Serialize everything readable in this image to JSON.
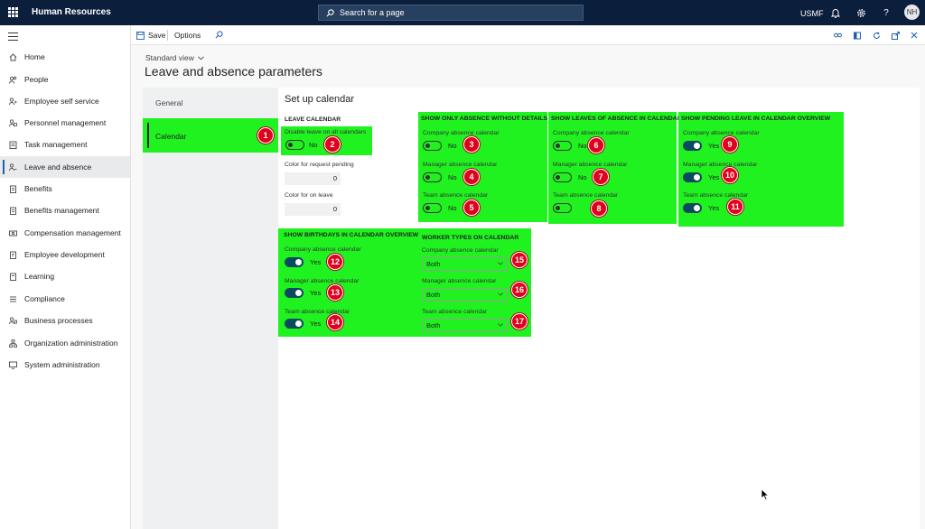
{
  "topbar": {
    "app_title": "Human Resources",
    "search_placeholder": "Search for a page",
    "company": "USMF",
    "user_initials": "NH",
    "icons": [
      "waffle-icon",
      "search-icon",
      "bell-icon",
      "gear-icon",
      "help-icon",
      "avatar"
    ]
  },
  "nav": {
    "items": [
      {
        "label": "Home",
        "icon": "home-icon"
      },
      {
        "label": "People",
        "icon": "people-icon"
      },
      {
        "label": "Employee self service",
        "icon": "self-service-icon"
      },
      {
        "label": "Personnel management",
        "icon": "personnel-icon"
      },
      {
        "label": "Task management",
        "icon": "task-icon"
      },
      {
        "label": "Leave and absence",
        "icon": "leave-icon",
        "active": true
      },
      {
        "label": "Benefits",
        "icon": "benefits-icon"
      },
      {
        "label": "Benefits management",
        "icon": "benefits-management-icon"
      },
      {
        "label": "Compensation management",
        "icon": "compensation-icon"
      },
      {
        "label": "Employee development",
        "icon": "development-icon"
      },
      {
        "label": "Learning",
        "icon": "learning-icon"
      },
      {
        "label": "Compliance",
        "icon": "compliance-icon"
      },
      {
        "label": "Business processes",
        "icon": "business-process-icon"
      },
      {
        "label": "Organization administration",
        "icon": "org-admin-icon"
      },
      {
        "label": "System administration",
        "icon": "system-admin-icon"
      }
    ]
  },
  "actionbar": {
    "save_label": "Save",
    "options_label": "Options"
  },
  "page": {
    "view_label": "Standard view",
    "title": "Leave and absence parameters",
    "tabs": {
      "general": "General",
      "calendar": "Calendar"
    },
    "section_title": "Set up calendar"
  },
  "leave_calendar": {
    "title": "LEAVE CALENDAR",
    "disable_label": "Disable leave on all calendars",
    "disable_value": "No",
    "pending_color_label": "Color for request pending",
    "pending_color_value": "0",
    "on_leave_color_label": "Color for on leave",
    "on_leave_color_value": "0"
  },
  "show_only_absence": {
    "title": "SHOW ONLY ABSENCE WITHOUT DETAILS",
    "company_label": "Company absence calendar",
    "company_value": "No",
    "manager_label": "Manager absence calendar",
    "manager_value": "No",
    "team_label": "Team absence calendar",
    "team_value": "No"
  },
  "show_leaves": {
    "title": "SHOW LEAVES OF ABSENCE IN CALENDAR",
    "company_label": "Company absence calendar",
    "company_value": "No",
    "manager_label": "Manager absence calendar",
    "manager_value": "No",
    "team_label": "Team absence calendar",
    "team_value": "No"
  },
  "show_pending": {
    "title": "SHOW PENDING LEAVE IN CALENDAR OVERVIEW",
    "company_label": "Company absence calendar",
    "company_value": "Yes",
    "manager_label": "Manager absence calendar",
    "manager_value": "Yes",
    "team_label": "Team absence calendar",
    "team_value": "Yes"
  },
  "show_birthdays": {
    "title": "SHOW BIRTHDAYS IN CALENDAR OVERVIEW",
    "company_label": "Company absence calendar",
    "company_value": "Yes",
    "manager_label": "Manager absence calendar",
    "manager_value": "Yes",
    "team_label": "Team absence calendar",
    "team_value": "Yes"
  },
  "worker_types": {
    "title": "WORKER TYPES ON CALENDAR",
    "company_label": "Company absence calendar",
    "company_value": "Both",
    "manager_label": "Manager absence calendar",
    "manager_value": "Both",
    "team_label": "Team absence calendar",
    "team_value": "Both"
  },
  "badges": [
    "1",
    "2",
    "3",
    "4",
    "5",
    "6",
    "7",
    "8",
    "9",
    "10",
    "11",
    "12",
    "13",
    "14",
    "15",
    "16",
    "17"
  ],
  "colors": {
    "highlight": "#1ff21f",
    "badge": "#e0001b",
    "topbar": "#0b1e3b",
    "accent": "#1e5fb4",
    "toggle_on": "#0b4a5e"
  }
}
